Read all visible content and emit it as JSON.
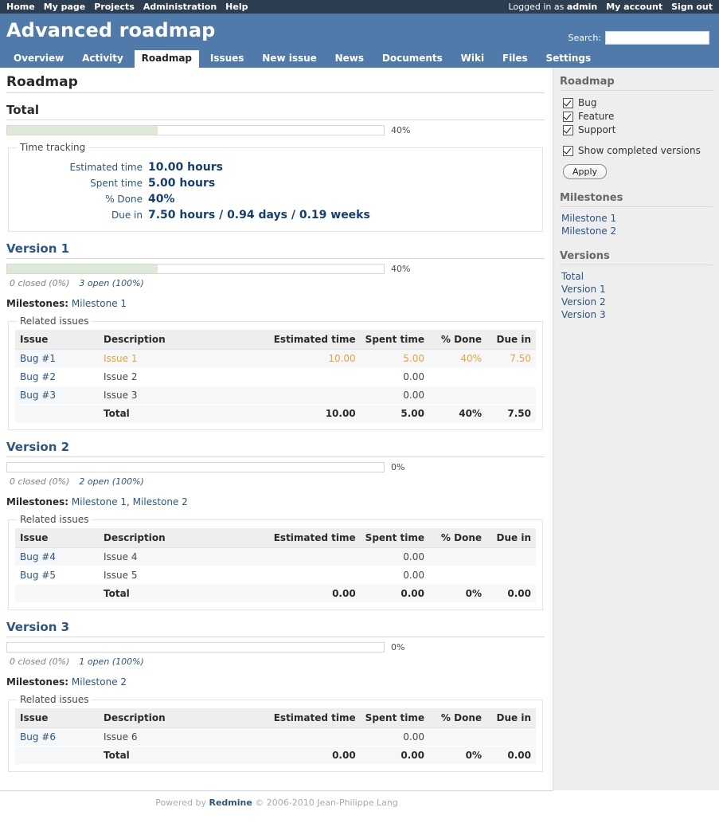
{
  "top_menu": {
    "items": [
      "Home",
      "My page",
      "Projects",
      "Administration",
      "Help"
    ],
    "logged_in_prefix": "Logged in as ",
    "user": "admin",
    "account_link": "My account",
    "signout_link": "Sign out"
  },
  "header": {
    "project_title": "Advanced roadmap",
    "search_label": "Search:",
    "search_value": "",
    "search_placeholder": ""
  },
  "main_menu": {
    "tabs": [
      {
        "label": "Overview",
        "selected": false
      },
      {
        "label": "Activity",
        "selected": false
      },
      {
        "label": "Roadmap",
        "selected": true
      },
      {
        "label": "Issues",
        "selected": false
      },
      {
        "label": "New issue",
        "selected": false
      },
      {
        "label": "News",
        "selected": false
      },
      {
        "label": "Documents",
        "selected": false
      },
      {
        "label": "Wiki",
        "selected": false
      },
      {
        "label": "Files",
        "selected": false
      },
      {
        "label": "Settings",
        "selected": false
      }
    ]
  },
  "page": {
    "title": "Roadmap"
  },
  "total_section": {
    "title": "Total",
    "progress_pct_label": "40%",
    "progress_closed_pct": 0,
    "progress_done_pct": 40,
    "time_tracking": {
      "legend": "Time tracking",
      "rows": [
        {
          "label": "Estimated time",
          "value": "10.00 hours"
        },
        {
          "label": "Spent time",
          "value": "5.00 hours"
        },
        {
          "label": "% Done",
          "value": "40%"
        },
        {
          "label": "Due in",
          "value": "7.50 hours / 0.94 days / 0.19 weeks"
        }
      ]
    }
  },
  "table_headers": [
    "Issue",
    "Description",
    "Estimated time",
    "Spent time",
    "% Done",
    "Due in"
  ],
  "related_issues_legend": "Related issues",
  "milestones_label": "Milestones:",
  "versions": [
    {
      "title": "Version 1",
      "progress_pct_label": "40%",
      "progress_closed_pct": 0,
      "progress_done_pct": 40,
      "closed_text": "0 closed (0%)",
      "open_text": "3 open (100%)",
      "milestones": [
        "Milestone 1"
      ],
      "rows": [
        {
          "issue": "Bug #1",
          "description": "Issue 1",
          "estimated": "10.00",
          "spent": "5.00",
          "done": "40%",
          "due": "7.50",
          "highlight": true
        },
        {
          "issue": "Bug #2",
          "description": "Issue 2",
          "estimated": "",
          "spent": "0.00",
          "done": "",
          "due": "",
          "highlight": false
        },
        {
          "issue": "Bug #3",
          "description": "Issue 3",
          "estimated": "",
          "spent": "0.00",
          "done": "",
          "due": "",
          "highlight": false
        }
      ],
      "total_row": {
        "issue": "",
        "description": "Total",
        "estimated": "10.00",
        "spent": "5.00",
        "done": "40%",
        "due": "7.50"
      }
    },
    {
      "title": "Version 2",
      "progress_pct_label": "0%",
      "progress_closed_pct": 0,
      "progress_done_pct": 0,
      "closed_text": "0 closed (0%)",
      "open_text": "2 open (100%)",
      "milestones": [
        "Milestone 1",
        "Milestone 2"
      ],
      "rows": [
        {
          "issue": "Bug #4",
          "description": "Issue 4",
          "estimated": "",
          "spent": "0.00",
          "done": "",
          "due": "",
          "highlight": false
        },
        {
          "issue": "Bug #5",
          "description": "Issue 5",
          "estimated": "",
          "spent": "0.00",
          "done": "",
          "due": "",
          "highlight": false
        }
      ],
      "total_row": {
        "issue": "",
        "description": "Total",
        "estimated": "0.00",
        "spent": "0.00",
        "done": "0%",
        "due": "0.00"
      }
    },
    {
      "title": "Version 3",
      "progress_pct_label": "0%",
      "progress_closed_pct": 0,
      "progress_done_pct": 0,
      "closed_text": "0 closed (0%)",
      "open_text": "1 open (100%)",
      "milestones": [
        "Milestone 2"
      ],
      "rows": [
        {
          "issue": "Bug #6",
          "description": "Issue 6",
          "estimated": "",
          "spent": "0.00",
          "done": "",
          "due": "",
          "highlight": false
        }
      ],
      "total_row": {
        "issue": "",
        "description": "Total",
        "estimated": "0.00",
        "spent": "0.00",
        "done": "0%",
        "due": "0.00"
      }
    }
  ],
  "sidebar": {
    "heading": "Roadmap",
    "tracker_filters": [
      {
        "label": "Bug",
        "checked": true
      },
      {
        "label": "Feature",
        "checked": true
      },
      {
        "label": "Support",
        "checked": true
      }
    ],
    "show_completed": {
      "label": "Show completed versions",
      "checked": true
    },
    "apply_label": "Apply",
    "milestones_heading": "Milestones",
    "milestones": [
      "Milestone 1",
      "Milestone 2"
    ],
    "versions_heading": "Versions",
    "version_links": [
      "Total",
      "Version 1",
      "Version 2",
      "Version 3"
    ]
  },
  "footer": {
    "powered_by": "Powered by ",
    "redmine": "Redmine",
    "copyright": " © 2006-2010 Jean-Philippe Lang"
  },
  "colors": {
    "top_bar": "#2c3e50",
    "header": "#507aaa",
    "link": "#2a5685",
    "highlight_orange": "#e8a33d",
    "progress_done": "#dfe9d8",
    "sidebar_bg": "#eeeeee"
  }
}
